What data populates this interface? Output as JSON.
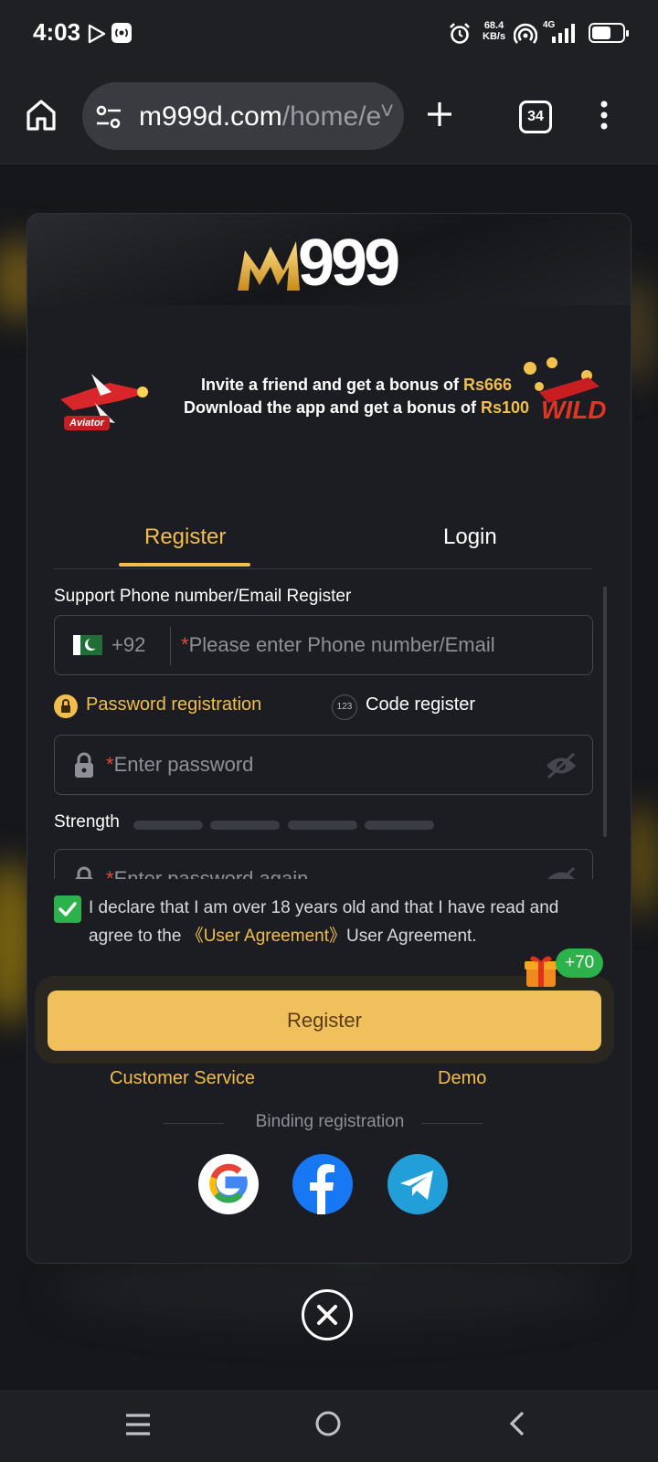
{
  "status_bar": {
    "time": "4:03",
    "net_speed_value": "68.4",
    "net_speed_unit": "KB/s",
    "network_type": "4G"
  },
  "browser": {
    "url_domain": "m999d.com",
    "url_path": "/home/eⱽ",
    "tab_count": "34"
  },
  "brand": {
    "logo_text": "999",
    "logo_mark": "M"
  },
  "banner": {
    "line1_prefix": "Invite a friend and get a bonus of ",
    "line1_amount": "Rs666",
    "line2_prefix": "Download the app and get a bonus of ",
    "line2_amount": "Rs100",
    "left_badge": "Aviator",
    "right_badge": "WILD"
  },
  "tabs": {
    "register": "Register",
    "login": "Login"
  },
  "form": {
    "support_label": "Support Phone number/Email Register",
    "country_code": "+92",
    "phone_required_mark": "*",
    "phone_placeholder": "Please enter Phone number/Email",
    "mode_password": "Password registration",
    "mode_code_icon": "123",
    "mode_code": "Code register",
    "password_required_mark": "*",
    "password_placeholder": "Enter password",
    "strength_label": "Strength",
    "password_again_required_mark": "*",
    "password_again_placeholder": "Enter password again"
  },
  "agreement": {
    "text_before": "I declare that I am over 18 years old and that I have read and agree to the ",
    "link": "《User Agreement》",
    "text_after": "User Agreement.",
    "checked": true
  },
  "register_button": "Register",
  "bonus_badge": "+70",
  "links": {
    "customer_service": "Customer Service",
    "demo": "Demo"
  },
  "binding_label": "Binding registration",
  "social": [
    "google-icon",
    "facebook-icon",
    "telegram-icon"
  ],
  "colors": {
    "accent_gold": "#f1be4e",
    "button_gold": "#efc05b",
    "check_green": "#2cb24a",
    "modal_bg": "#1c1d22"
  }
}
